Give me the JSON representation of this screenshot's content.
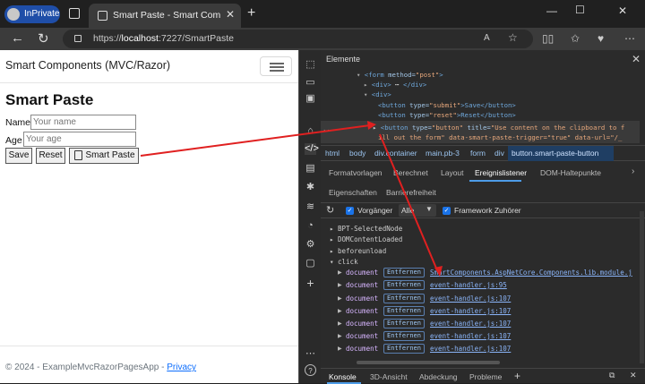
{
  "browser": {
    "inprivate_label": "InPrivate",
    "tab_title": "Smart Paste - Smart Components",
    "url_scheme": "https://",
    "url_host": "localhost",
    "url_rest": ":7227/SmartPaste",
    "read_aloud_label": "A"
  },
  "page": {
    "brand": "Smart Components (MVC/Razor)",
    "heading": "Smart Paste",
    "name_label": "Name",
    "name_placeholder": "Your name",
    "age_label": "Age",
    "age_placeholder": "Your age",
    "save_label": "Save",
    "reset_label": "Reset",
    "smart_paste_label": "Smart Paste",
    "footer_text": "© 2024 - ExampleMvcRazorPagesApp - ",
    "footer_link": "Privacy"
  },
  "devtools": {
    "title": "Elemente",
    "dots": "...",
    "dom_lines": [
      {
        "tag_open": "<form ",
        "attr": "method=",
        "val": "\"post\"",
        "close": ">"
      },
      {
        "tag_open": "<div>",
        "attr": "",
        "val": " ⋯ ",
        "close": "</div>"
      },
      {
        "tag_open": "<div>",
        "attr": "",
        "val": "",
        "close": ""
      },
      {
        "tag_open": "<button ",
        "attr": "type=",
        "val": "\"submit\"",
        "close": ">Save</button>"
      },
      {
        "tag_open": "<button ",
        "attr": "type=",
        "val": "\"reset\"",
        "close": ">Reset</button>"
      }
    ],
    "selected_line1_tag": "<button ",
    "selected_line1_attr": "type=",
    "selected_line1_val": "\"button\"",
    "selected_line1_attr2": " title=",
    "selected_line1_val2": "\"Use content on the clipboard to f",
    "selected_line2": "ill out the form\" data-smart-paste-trigger=\"true\" data-url=\"/_",
    "breadcrumbs": [
      "html",
      "body",
      "div.container",
      "main.pb-3",
      "form",
      "div",
      "button.smart-paste-button"
    ],
    "subtabs": [
      "Formatvorlagen",
      "Berechnet",
      "Layout",
      "Ereignislistener",
      "DOM-Haltepunkte",
      "Eigenschaften",
      "Barrierefreiheit"
    ],
    "filter_ancestors": "Vorgänger",
    "filter_select": "Alle",
    "filter_framework": "Framework Zuhörer",
    "events": [
      "BPT-SelectedNode",
      "DOMContentLoaded",
      "beforeunload",
      "click"
    ],
    "listener_node": "document",
    "remove_label": "Entfernen",
    "listeners": [
      "SmartComponents.AspNetCore.Components.lib.module.j",
      "event-handler.js:95",
      "event-handler.js:107",
      "event-handler.js:107",
      "event-handler.js:107",
      "event-handler.js:107",
      "event-handler.js:107"
    ],
    "drawer_tabs": [
      "Konsole",
      "3D-Ansicht",
      "Abdeckung",
      "Probleme"
    ]
  }
}
